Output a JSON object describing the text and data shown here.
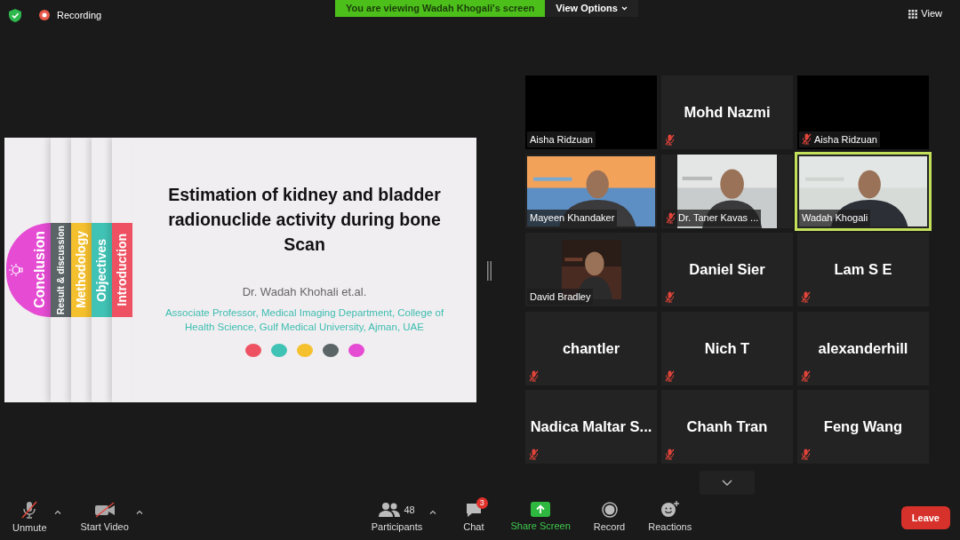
{
  "top_bar": {
    "recording": "Recording",
    "banner": "You are viewing Wadah Khogali's screen",
    "view_options": "View Options",
    "view": "View"
  },
  "slide": {
    "tabs": [
      {
        "label": "Conclusion",
        "color": "#e54bd3"
      },
      {
        "label": "Result & discussion",
        "color": "#5b6466"
      },
      {
        "label": "Methodology",
        "color": "#f5c02e"
      },
      {
        "label": "Objectives",
        "color": "#40c2b4"
      },
      {
        "label": "Introduction",
        "color": "#ee5262"
      }
    ],
    "title": "Estimation of kidney and bladder radionuclide activity during bone Scan",
    "author": "Dr. Wadah Khohali et.al.",
    "affiliation": "Associate Professor, Medical Imaging Department, College of Health Science, Gulf Medical University, Ajman, UAE",
    "dots": [
      {
        "color": "#ee5262"
      },
      {
        "color": "#40c2b4"
      },
      {
        "color": "#f5c02e"
      },
      {
        "color": "#5b6466"
      },
      {
        "color": "#e54bd3"
      }
    ]
  },
  "gallery": {
    "tiles": [
      {
        "name": "Aisha Ridzuan",
        "kind": "black",
        "muted": false,
        "speaking": false
      },
      {
        "name": "Mohd Nazmi",
        "kind": "name",
        "muted": true,
        "speaking": false
      },
      {
        "name": "Aisha Ridzuan",
        "kind": "black",
        "muted": true,
        "speaking": false
      },
      {
        "name": "Mayeen Khandaker",
        "kind": "camera",
        "muted": false,
        "speaking": false
      },
      {
        "name": "Dr. Taner Kavas ...",
        "kind": "camera_inset",
        "muted": true,
        "speaking": false
      },
      {
        "name": "Wadah Khogali",
        "kind": "camera",
        "muted": false,
        "speaking": true
      },
      {
        "name": "David Bradley",
        "kind": "avatar",
        "muted": false,
        "speaking": false
      },
      {
        "name": "Daniel Sier",
        "kind": "name",
        "muted": true,
        "speaking": false
      },
      {
        "name": "Lam S E",
        "kind": "name",
        "muted": true,
        "speaking": false
      },
      {
        "name": "chantler",
        "kind": "name",
        "muted": true,
        "speaking": false
      },
      {
        "name": "Nich T",
        "kind": "name",
        "muted": true,
        "speaking": false
      },
      {
        "name": "alexanderhill",
        "kind": "name",
        "muted": true,
        "speaking": false
      },
      {
        "name": "Nadica Maltar S...",
        "kind": "name",
        "muted": true,
        "speaking": false
      },
      {
        "name": "Chanh Tran",
        "kind": "name",
        "muted": true,
        "speaking": false
      },
      {
        "name": "Feng Wang",
        "kind": "name",
        "muted": true,
        "speaking": false
      }
    ]
  },
  "toolbar": {
    "items": [
      {
        "label": "Unmute",
        "kind": "mic",
        "caret": true
      },
      {
        "label": "Start Video",
        "kind": "video",
        "caret": true
      },
      {
        "label": "Participants",
        "kind": "participants",
        "count": "48",
        "caret": true
      },
      {
        "label": "Chat",
        "kind": "chat",
        "badge": "3"
      },
      {
        "label": "Share Screen",
        "kind": "share"
      },
      {
        "label": "Record",
        "kind": "record"
      },
      {
        "label": "Reactions",
        "kind": "reactions"
      }
    ],
    "leave": "Leave"
  }
}
